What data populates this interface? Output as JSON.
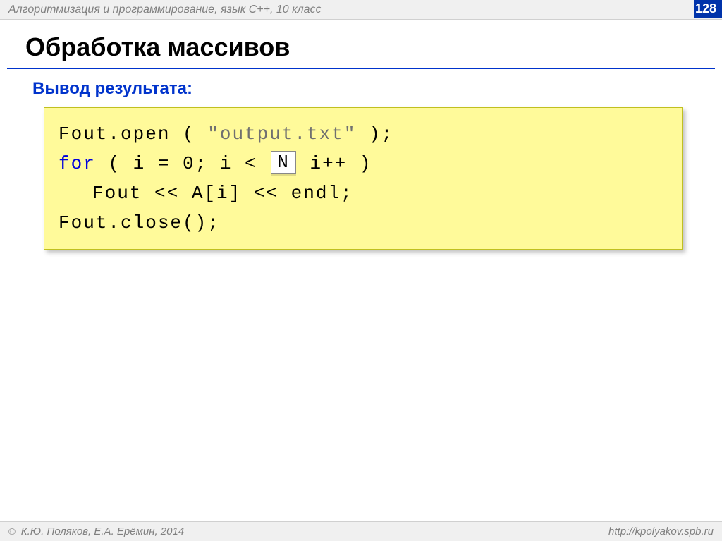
{
  "header": {
    "course": "Алгоритмизация и программирование, язык C++, 10 класс",
    "pageNumber": "128"
  },
  "title": "Обработка массивов",
  "subtitle": "Вывод результата:",
  "code": {
    "line1_a": "Fout.open ( ",
    "line1_str": "\"output.txt\"",
    "line1_b": " );",
    "line2_kw": "for",
    "line2_a": " ( i = ",
    "line2_num": "0",
    "line2_b": "; i < ",
    "line2_box": "N",
    "line2_c": "  i++ )",
    "line3": "Fout << A[i] << endl;",
    "line4": "Fout.close();"
  },
  "footer": {
    "copyright": "К.Ю. Поляков, Е.А. Ерёмин, 2014",
    "url": "http://kpolyakov.spb.ru"
  }
}
